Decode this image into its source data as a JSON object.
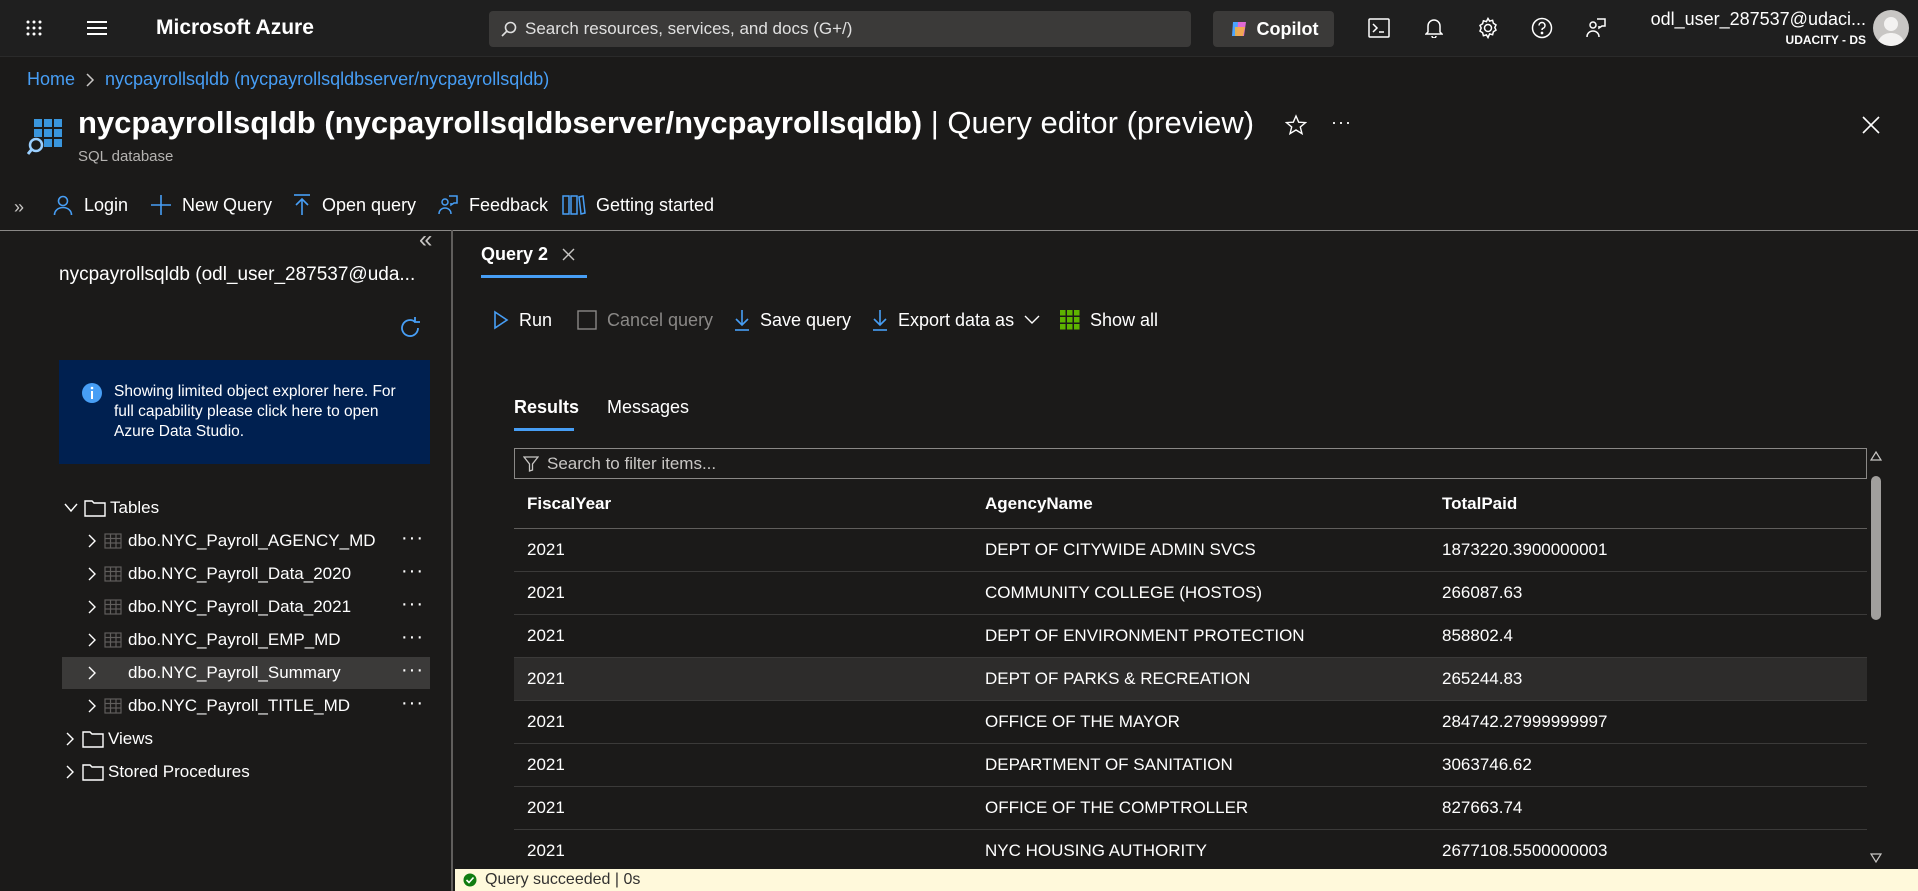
{
  "topbar": {
    "brand": "Microsoft Azure",
    "search_placeholder": "Search resources, services, and docs (G+/)",
    "copilot_label": "Copilot",
    "user_name": "odl_user_287537@udaci...",
    "user_tenant": "UDACITY - DS"
  },
  "breadcrumb": {
    "home": "Home",
    "current": "nycpayrollsqldb (nycpayrollsqldbserver/nycpayrollsqldb)"
  },
  "header": {
    "title_bold": "nycpayrollsqldb (nycpayrollsqldbserver/nycpayrollsqldb)",
    "title_rest": " | Query editor (preview)",
    "subtitle": "SQL database"
  },
  "commands": {
    "login": "Login",
    "new_query": "New Query",
    "open_query": "Open query",
    "feedback": "Feedback",
    "getting_started": "Getting started"
  },
  "explorer": {
    "db_title": "nycpayrollsqldb (odl_user_287537@uda...",
    "info": "Showing limited object explorer here. For full capability please click here to open Azure Data Studio.",
    "tables_label": "Tables",
    "tables": [
      "dbo.NYC_Payroll_AGENCY_MD",
      "dbo.NYC_Payroll_Data_2020",
      "dbo.NYC_Payroll_Data_2021",
      "dbo.NYC_Payroll_EMP_MD",
      "dbo.NYC_Payroll_Summary",
      "dbo.NYC_Payroll_TITLE_MD"
    ],
    "views_label": "Views",
    "procs_label": "Stored Procedures"
  },
  "query": {
    "tab_label": "Query 2",
    "run": "Run",
    "cancel": "Cancel query",
    "save": "Save query",
    "export": "Export data as",
    "show_all": "Show all",
    "results_tab": "Results",
    "messages_tab": "Messages",
    "filter_placeholder": "Search to filter items...",
    "columns": [
      "FiscalYear",
      "AgencyName",
      "TotalPaid"
    ],
    "rows": [
      [
        "2021",
        "DEPT OF CITYWIDE ADMIN SVCS",
        "1873220.3900000001"
      ],
      [
        "2021",
        "COMMUNITY COLLEGE (HOSTOS)",
        "266087.63"
      ],
      [
        "2021",
        "DEPT OF ENVIRONMENT PROTECTION",
        "858802.4"
      ],
      [
        "2021",
        "DEPT OF PARKS & RECREATION",
        "265244.83"
      ],
      [
        "2021",
        "OFFICE OF THE MAYOR",
        "284742.27999999997"
      ],
      [
        "2021",
        "DEPARTMENT OF SANITATION",
        "3063746.62"
      ],
      [
        "2021",
        "OFFICE OF THE COMPTROLLER",
        "827663.74"
      ],
      [
        "2021",
        "NYC HOUSING AUTHORITY",
        "2677108.5500000003"
      ]
    ],
    "status": "Query succeeded | 0s"
  }
}
